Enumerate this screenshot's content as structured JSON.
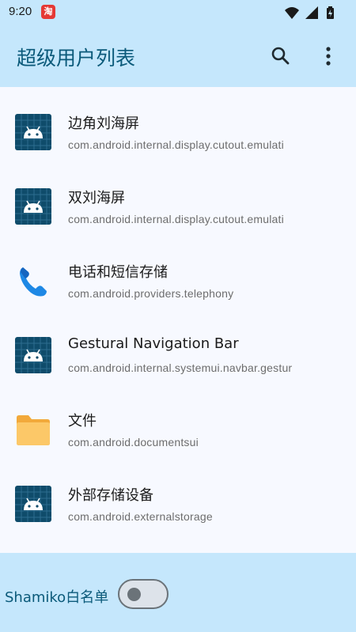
{
  "status": {
    "time": "9:20",
    "notification_badge": "淘"
  },
  "app": {
    "title": "超级用户列表"
  },
  "items": [
    {
      "title": "边角刘海屏",
      "package": "com.android.internal.display.cutout.emulati",
      "icon": "android-icon"
    },
    {
      "title": "双刘海屏",
      "package": "com.android.internal.display.cutout.emulati",
      "icon": "android-icon"
    },
    {
      "title": "电话和短信存储",
      "package": "com.android.providers.telephony",
      "icon": "phone-icon"
    },
    {
      "title": "Gestural Navigation Bar",
      "package": "com.android.internal.systemui.navbar.gestur",
      "icon": "android-icon"
    },
    {
      "title": "文件",
      "package": "com.android.documentsui",
      "icon": "folder-icon"
    },
    {
      "title": "外部存储设备",
      "package": "com.android.externalstorage",
      "icon": "android-icon"
    }
  ],
  "bottom": {
    "shamiko_label": "Shamiko白名单",
    "toggle_on": false
  },
  "colors": {
    "bar_bg": "#c5e7fc",
    "accent": "#0b5a7a",
    "list_bg": "#f7f9ff"
  }
}
